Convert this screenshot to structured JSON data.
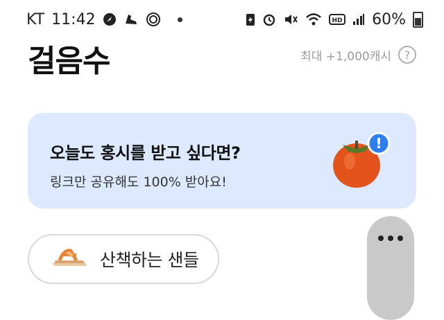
{
  "status_bar": {
    "carrier": "KT",
    "time": "11:42",
    "network": "HD",
    "battery": "60%",
    "left_icons": [
      "compass-icon",
      "shoe-icon",
      "settings-ring-icon"
    ],
    "right_icons": [
      "battery-saver-icon",
      "alarm-icon",
      "mute-icon",
      "wifi-icon",
      "hd-icon",
      "signal-icon"
    ]
  },
  "header": {
    "title": "걸음수",
    "max_reward": "최대 +1,000캐시",
    "help_icon": "help-icon"
  },
  "promo": {
    "title": "오늘도 홍시를 받고 싶다면?",
    "subtitle": "링크만 공유해도 100% 받아요!",
    "image": "persimmon-icon",
    "badge": "!"
  },
  "walk_chip": {
    "label": "산책하는 샌들",
    "icon": "sandal-icon"
  },
  "floating_menu": {
    "icon": "more-dots-icon"
  },
  "colors": {
    "promo_bg": "#dde9ff",
    "badge_blue": "#2d7ff0",
    "persimmon": "#e5531c"
  }
}
